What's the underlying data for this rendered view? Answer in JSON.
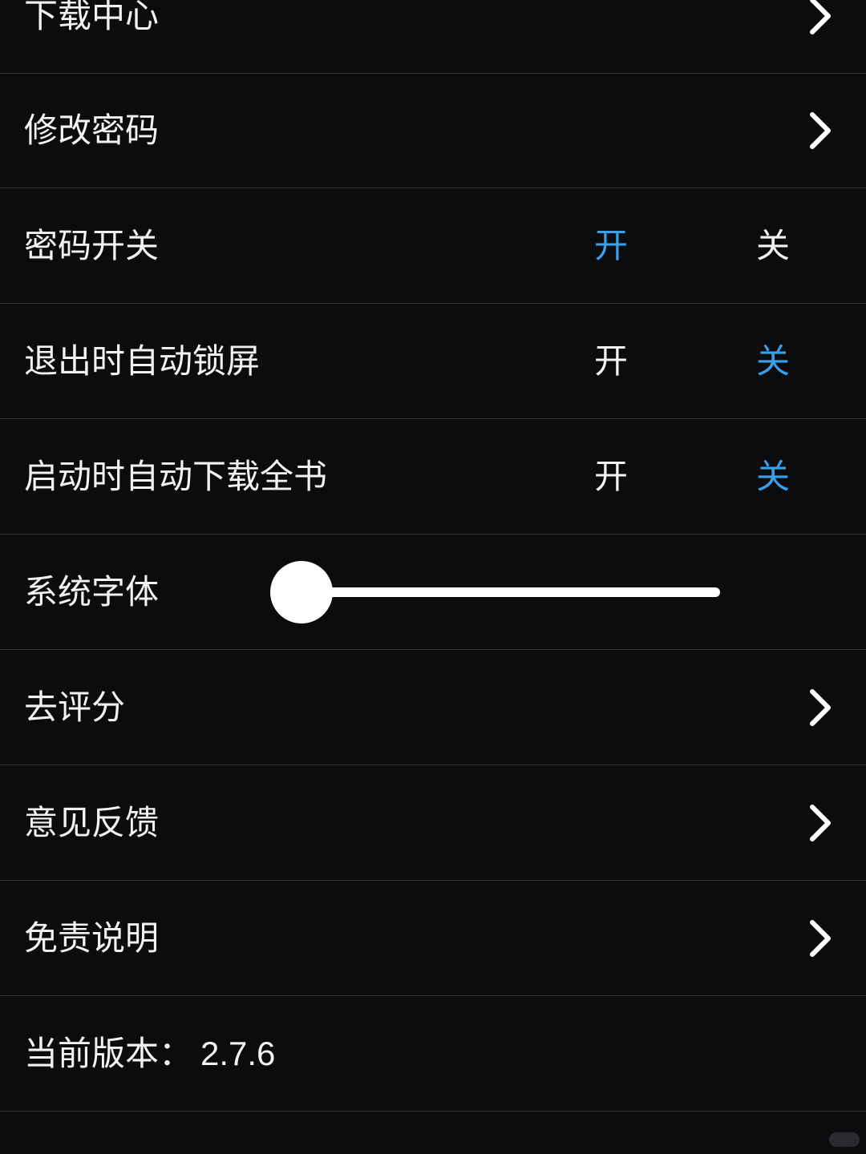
{
  "settings": {
    "download_center": {
      "label": "下载中心"
    },
    "change_password": {
      "label": "修改密码"
    },
    "password_switch": {
      "label": "密码开关",
      "on_label": "开",
      "off_label": "关",
      "value": "on"
    },
    "auto_lock_on_exit": {
      "label": "退出时自动锁屏",
      "on_label": "开",
      "off_label": "关",
      "value": "off"
    },
    "auto_download_book": {
      "label": "启动时自动下载全书",
      "on_label": "开",
      "off_label": "关",
      "value": "off"
    },
    "system_font": {
      "label": "系统字体",
      "slider_value": 0
    },
    "rate": {
      "label": "去评分"
    },
    "feedback": {
      "label": "意见反馈"
    },
    "disclaimer": {
      "label": "免责说明"
    },
    "version": {
      "label": "当前版本：",
      "value": "2.7.6"
    }
  },
  "icons": {
    "row_arrow": "chevron-right-icon"
  },
  "colors": {
    "background": "#0b0c0e",
    "divider": "#2e3034",
    "text": "#f2f2f2",
    "accent": "#3aa0ea"
  }
}
